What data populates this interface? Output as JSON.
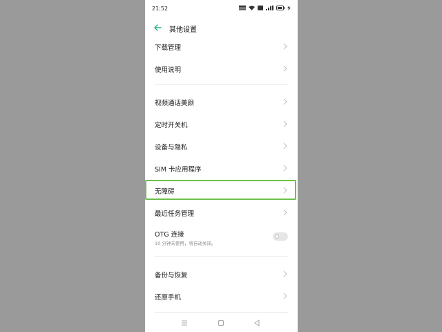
{
  "status_bar": {
    "time": "21:52",
    "icons": [
      "data-speed-icon",
      "wifi-icon",
      "hd-icon",
      "signal-icon",
      "battery-icon",
      "charging-icon"
    ]
  },
  "header": {
    "title": "其他设置",
    "back_icon": "back-arrow-icon"
  },
  "settings": {
    "items": [
      {
        "label": "下载管理"
      },
      {
        "label": "使用说明"
      },
      {
        "label": "视频通话美颜"
      },
      {
        "label": "定时开关机"
      },
      {
        "label": "设备与隐私"
      },
      {
        "label": "SIM 卡应用程序"
      },
      {
        "label": "无障碍"
      },
      {
        "label": "最近任务管理"
      },
      {
        "label": "OTG 连接",
        "description": "10 分钟未使用，将自动关闭。",
        "toggle": "off"
      },
      {
        "label": "备份与恢复"
      },
      {
        "label": "还原手机"
      }
    ]
  },
  "highlight": {
    "color": "#6cc04a",
    "item": "无障碍"
  },
  "nav_bar": {
    "icons": [
      "menu-icon",
      "home-icon",
      "back-icon"
    ]
  },
  "colors": {
    "accent": "#2bb07f",
    "background": "#9a9a9a"
  }
}
